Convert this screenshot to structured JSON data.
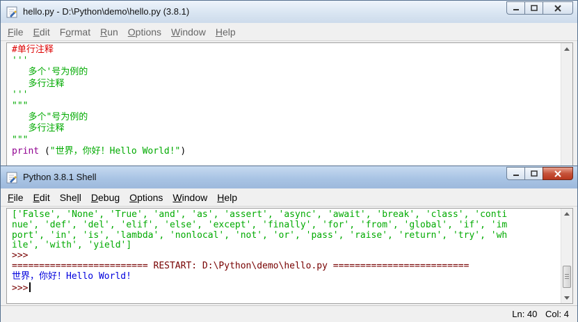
{
  "editor": {
    "title": "hello.py - D:\\Python\\demo\\hello.py (3.8.1)",
    "menu": [
      {
        "pre": "",
        "u": "F",
        "post": "ile"
      },
      {
        "pre": "",
        "u": "E",
        "post": "dit"
      },
      {
        "pre": "F",
        "u": "o",
        "post": "rmat"
      },
      {
        "pre": "",
        "u": "R",
        "post": "un"
      },
      {
        "pre": "",
        "u": "O",
        "post": "ptions"
      },
      {
        "pre": "",
        "u": "W",
        "post": "indow"
      },
      {
        "pre": "",
        "u": "H",
        "post": "elp"
      }
    ],
    "code_lines": [
      {
        "text": "#单行注释",
        "color": "red"
      },
      {
        "text": "'''",
        "color": "green"
      },
      {
        "text": "   多个'号为例的",
        "color": "green"
      },
      {
        "text": "   多行注释",
        "color": "green"
      },
      {
        "text": "'''",
        "color": "green"
      },
      {
        "text": "\"\"\"",
        "color": "green"
      },
      {
        "text": "   多个\"号为例的",
        "color": "green"
      },
      {
        "text": "   多行注释",
        "color": "green"
      },
      {
        "text": "\"\"\"",
        "color": "green"
      }
    ],
    "print_line": {
      "keyword": "print",
      "open": " (",
      "string": "\"世界，你好！Hello World!\"",
      "close": ")"
    }
  },
  "shell": {
    "title": "Python 3.8.1 Shell",
    "menu": [
      {
        "pre": "",
        "u": "F",
        "post": "ile"
      },
      {
        "pre": "",
        "u": "E",
        "post": "dit"
      },
      {
        "pre": "She",
        "u": "l",
        "post": "l"
      },
      {
        "pre": "",
        "u": "D",
        "post": "ebug"
      },
      {
        "pre": "",
        "u": "O",
        "post": "ptions"
      },
      {
        "pre": "",
        "u": "W",
        "post": "indow"
      },
      {
        "pre": "",
        "u": "H",
        "post": "elp"
      }
    ],
    "output_lines": [
      {
        "text": "['False', 'None', 'True', 'and', 'as', 'assert', 'async', 'await', 'break', 'class', 'conti",
        "color": "green"
      },
      {
        "text": "nue', 'def', 'del', 'elif', 'else', 'except', 'finally', 'for', 'from', 'global', 'if', 'im",
        "color": "green"
      },
      {
        "text": "port', 'in', 'is', 'lambda', 'nonlocal', 'not', 'or', 'pass', 'raise', 'return', 'try', 'wh",
        "color": "green"
      },
      {
        "text": "ile', 'with', 'yield']",
        "color": "green"
      },
      {
        "text": ">>>",
        "color": "prompt"
      },
      {
        "text": "========================= RESTART: D:\\Python\\demo\\hello.py =========================",
        "color": "darkred"
      },
      {
        "text": "世界，你好！Hello World!",
        "color": "blue"
      }
    ],
    "prompt": ">>>",
    "status": {
      "line": "Ln: 40",
      "col": "Col: 4"
    }
  },
  "colors": {
    "comment_red": "#dd0000",
    "string_green": "#00aa00",
    "keyword_purple": "#900090",
    "stdout_blue": "#0000dd",
    "prompt_darkred": "#770000"
  },
  "icons": [
    "python-idle-icon",
    "minimize-icon",
    "maximize-icon",
    "close-icon"
  ]
}
